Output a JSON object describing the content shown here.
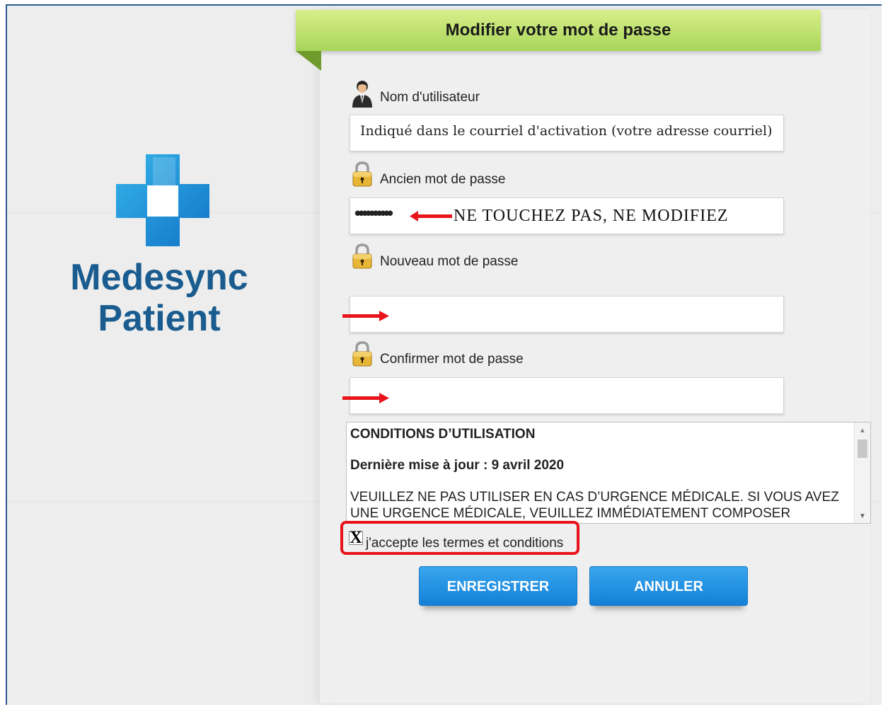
{
  "brand": {
    "line1": "Medesync",
    "line2": "Patient"
  },
  "header": {
    "title": "Modifier votre mot de passe"
  },
  "fields": {
    "username": {
      "label": "Nom d'utilisateur",
      "value": "Indiqué dans le courriel d'activation (votre adresse courriel)"
    },
    "old_password": {
      "label": "Ancien mot de passe",
      "masked": "••••••••••",
      "note": "NE TOUCHEZ PAS, NE MODIFIEZ"
    },
    "new_password": {
      "label": "Nouveau mot de passe",
      "value": ""
    },
    "confirm_password": {
      "label": "Confirmer mot de passe",
      "value": ""
    }
  },
  "terms": {
    "title": "CONDITIONS D’UTILISATION",
    "updated": "Dernière mise à jour : 9 avril 2020",
    "body": "VEUILLEZ NE PAS UTILISER EN CAS D’URGENCE MÉDICALE. SI VOUS AVEZ UNE URGENCE MÉDICALE, VEUILLEZ IMMÉDIATEMENT COMPOSER"
  },
  "accept": {
    "checkbox_mark": "X",
    "label": "j'accepte les termes et conditions",
    "checked": true
  },
  "buttons": {
    "save": "ENREGISTRER",
    "cancel": "ANNULER"
  },
  "colors": {
    "brand_blue": "#1a5c8f",
    "ribbon_green": "#c2e275",
    "button_blue": "#1f8fe3",
    "highlight_red": "#e8141b"
  },
  "icons": {
    "user": "user-icon",
    "lock": "lock-icon",
    "arrow": "red-arrow-icon",
    "logo": "medical-cross-icon"
  }
}
